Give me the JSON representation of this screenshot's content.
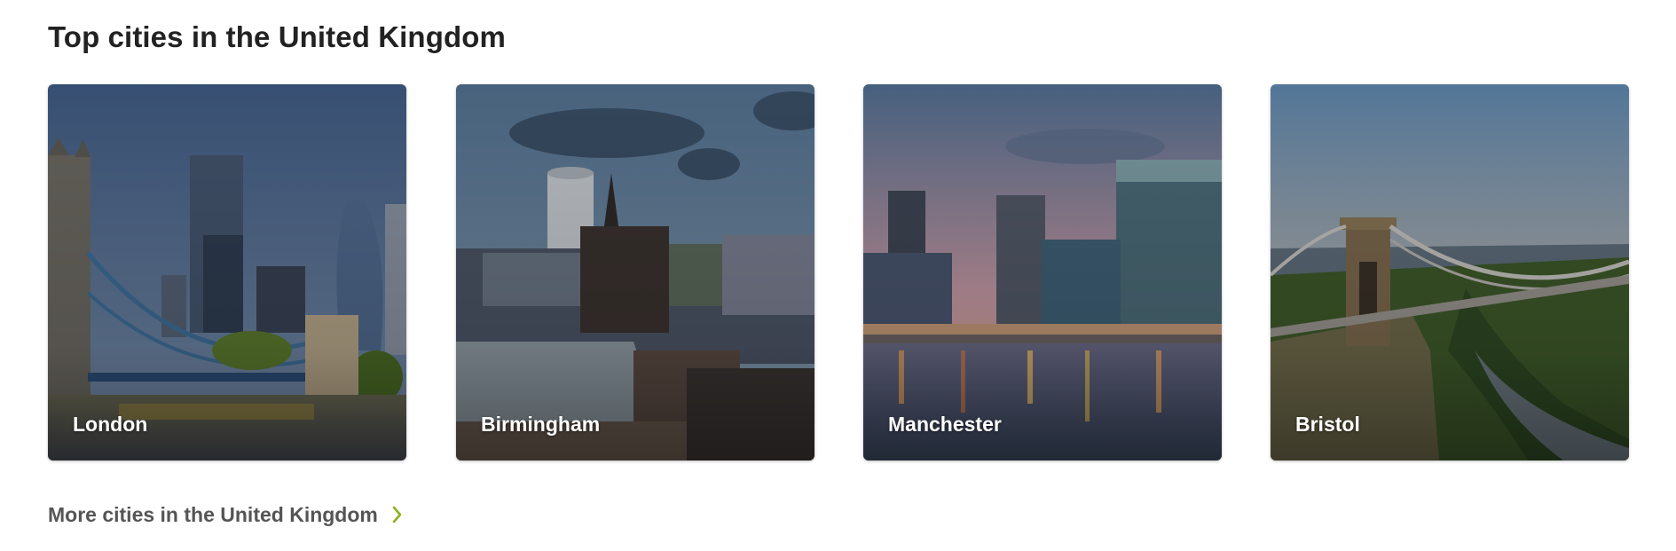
{
  "section": {
    "title": "Top cities in the United Kingdom"
  },
  "cities": [
    {
      "name": "London"
    },
    {
      "name": "Birmingham"
    },
    {
      "name": "Manchester"
    },
    {
      "name": "Bristol"
    }
  ],
  "more_link": {
    "label": "More cities in the United Kingdom",
    "icon": "chevron-right-icon"
  },
  "colors": {
    "title_text": "#222222",
    "link_text": "#555555",
    "chevron_accent": "#8ab21d",
    "card_label": "#ffffff"
  }
}
